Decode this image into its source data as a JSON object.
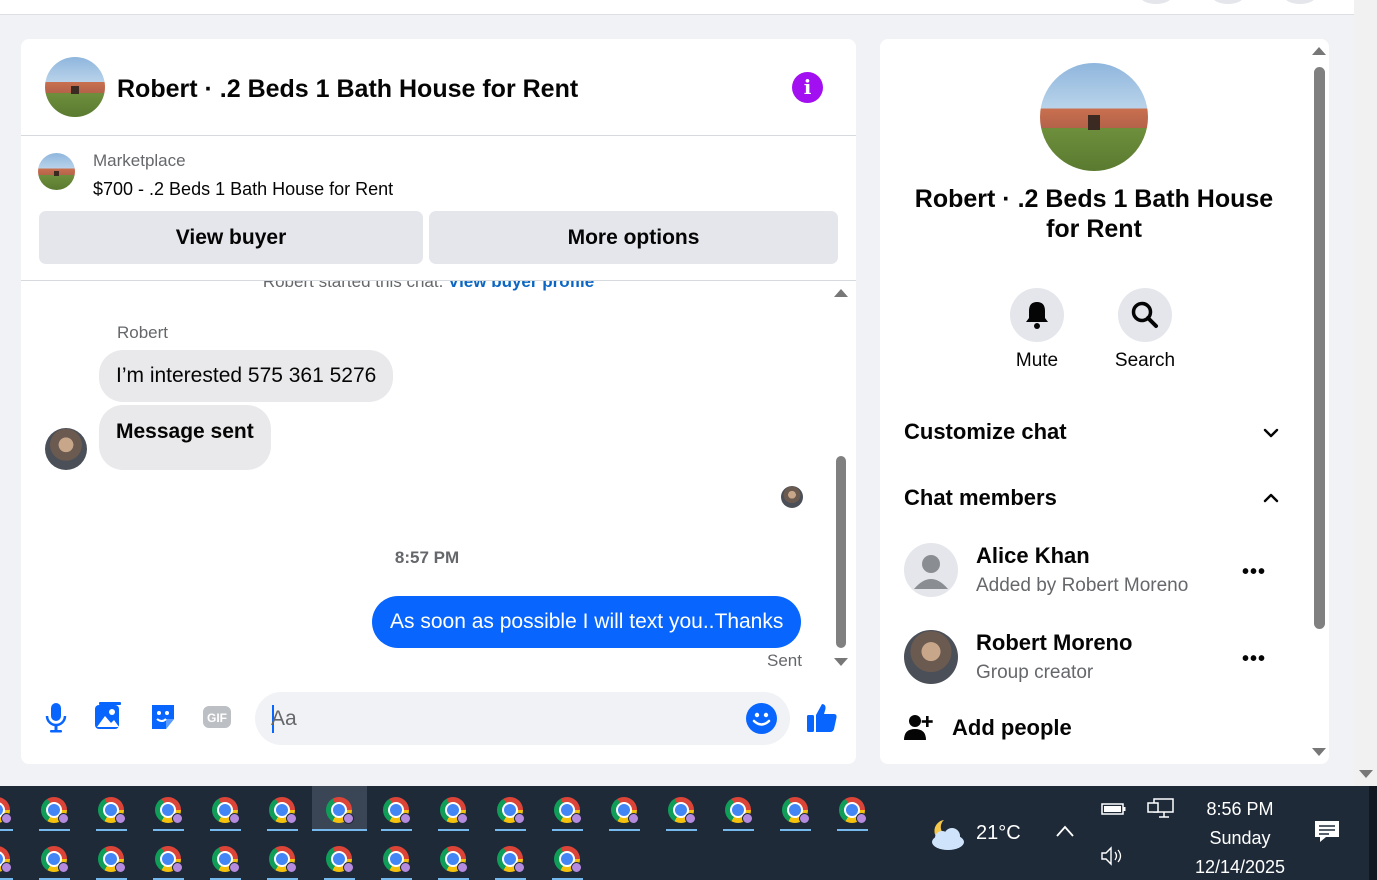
{
  "chat": {
    "title": "Robert · .2 Beds 1 Bath House for Rent",
    "info_icon": "info-icon",
    "marketplace_label": "Marketplace",
    "listing": "$700 - .2 Beds 1 Bath House for Rent",
    "view_buyer_label": "View buyer",
    "more_options_label": "More options",
    "started_text": "Robert started this chat.",
    "view_buyer_profile_link": "View buyer profile",
    "sender_name": "Robert",
    "incoming_messages": [
      "I’m interested 575 361 5276",
      "Message sent"
    ],
    "timestamp": "8:57 PM",
    "outgoing_message": "As soon as possible I will text you..Thanks",
    "sent_status": "Sent",
    "composer_placeholder": "Aa",
    "composer_icons": [
      "microphone-icon",
      "photo-icon",
      "sticker-icon",
      "gif-icon",
      "emoji-icon",
      "thumbs-up-icon"
    ]
  },
  "info_panel": {
    "title": "Robert · .2 Beds 1 Bath House for Rent",
    "actions": [
      {
        "label": "Mute",
        "icon": "bell-icon"
      },
      {
        "label": "Search",
        "icon": "search-icon"
      }
    ],
    "customize_chat_label": "Customize chat",
    "chat_members_label": "Chat members",
    "members": [
      {
        "name": "Alice Khan",
        "subtitle": "Added by Robert Moreno",
        "more": "•••"
      },
      {
        "name": "Robert Moreno",
        "subtitle": "Group creator",
        "more": "•••"
      }
    ],
    "add_people_label": "Add people"
  },
  "taskbar": {
    "app_icon": "chrome-icon",
    "weather": {
      "temp": "21°C",
      "icon": "partly-cloudy-night-icon"
    },
    "clock": {
      "time": "8:56 PM",
      "day": "Sunday",
      "date": "12/14/2025"
    },
    "tray_icons": [
      "chevron-up-icon",
      "battery-icon",
      "network-icon",
      "volume-icon",
      "notification-icon"
    ]
  },
  "colors": {
    "accent_blue": "#0866ff",
    "info_purple": "#a20ff0",
    "bubble_gray": "#e9e9eb",
    "taskbar": "#1f2a38"
  }
}
